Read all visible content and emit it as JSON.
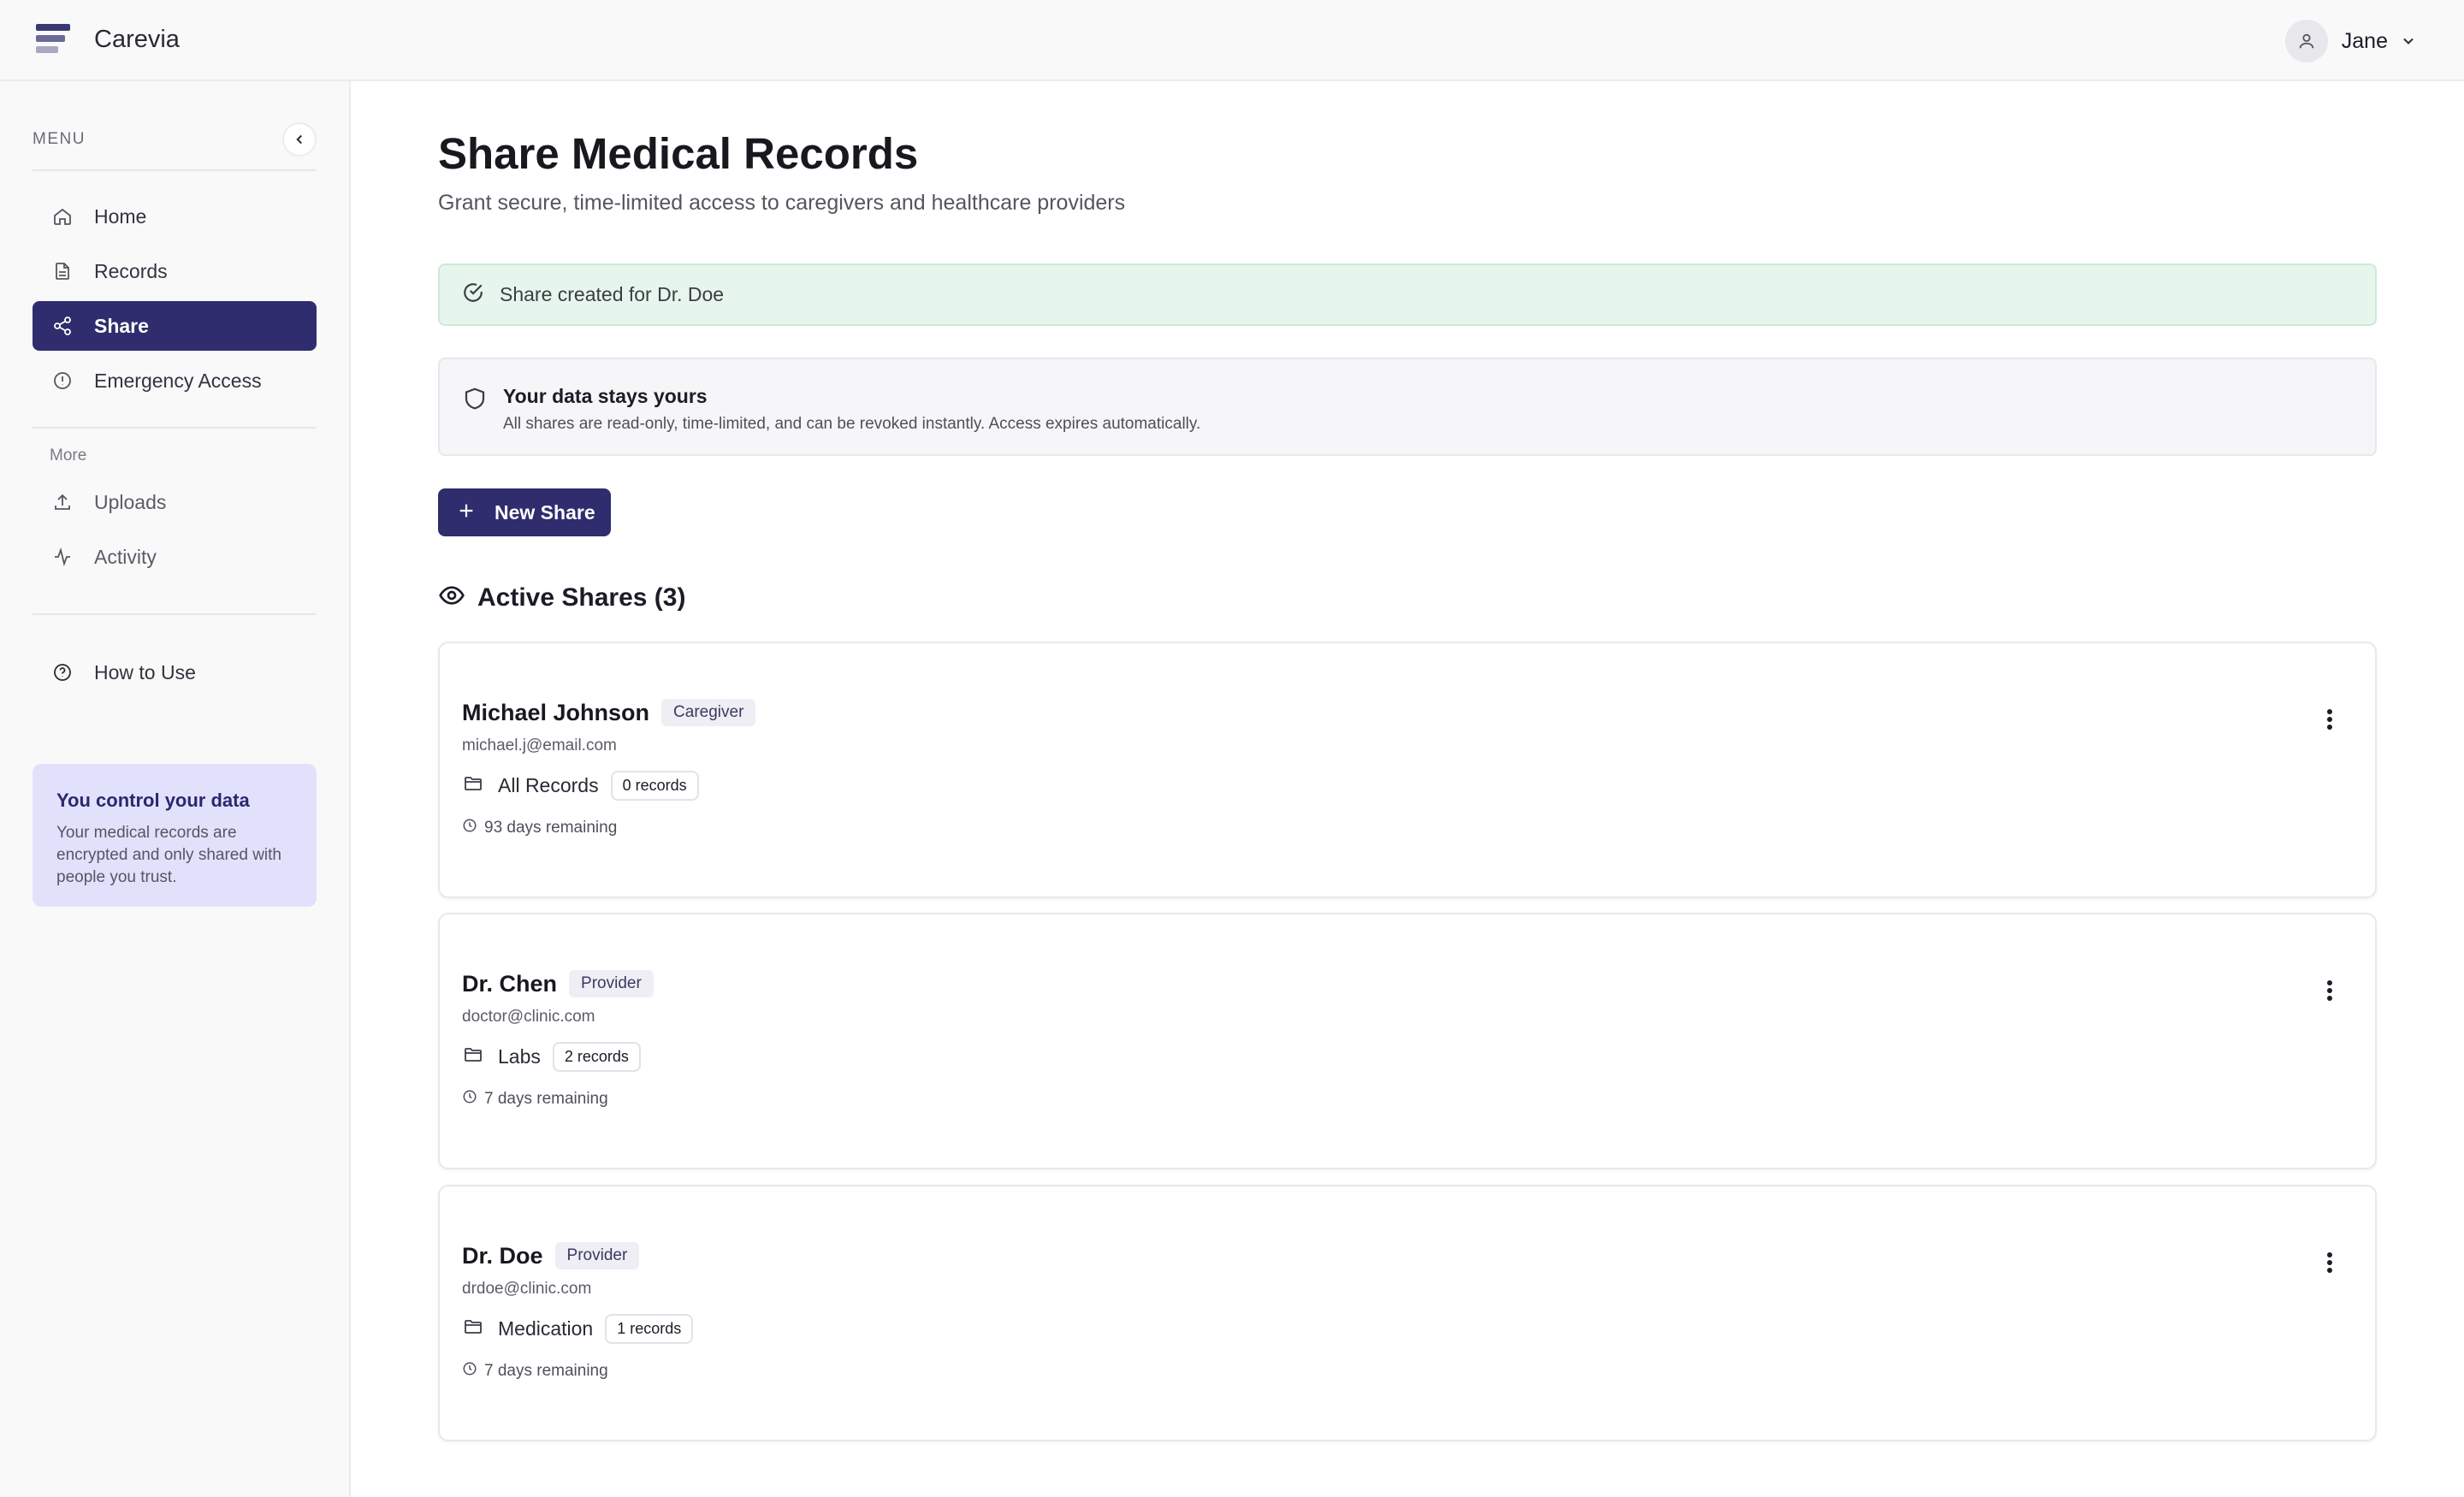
{
  "app": {
    "name": "Carevia"
  },
  "user": {
    "name": "Jane"
  },
  "sidebar": {
    "menu_label": "MENU",
    "main_items": [
      {
        "label": "Home",
        "icon": "home-icon"
      },
      {
        "label": "Records",
        "icon": "file-icon"
      },
      {
        "label": "Share",
        "icon": "share-icon",
        "active": true
      },
      {
        "label": "Emergency Access",
        "icon": "alert-circle-icon"
      }
    ],
    "more_label": "More",
    "more_items": [
      {
        "label": "Uploads",
        "icon": "upload-icon"
      },
      {
        "label": "Activity",
        "icon": "activity-icon"
      }
    ],
    "help_item": {
      "label": "How to Use",
      "icon": "help-circle-icon"
    },
    "info_card": {
      "title": "You control your data",
      "text": "Your medical records are encrypted and only shared with people you trust."
    }
  },
  "page": {
    "title": "Share Medical Records",
    "subtitle": "Grant secure, time-limited access to caregivers and healthcare providers"
  },
  "alert": {
    "text": "Share created for Dr. Doe",
    "icon": "check-circle-icon"
  },
  "privacy": {
    "title": "Your data stays yours",
    "text": "All shares are read-only, time-limited, and can be revoked instantly. Access expires automatically.",
    "icon": "shield-icon"
  },
  "new_share_button": {
    "label": "New Share"
  },
  "active_shares": {
    "heading": "Active Shares (3)",
    "items": [
      {
        "name": "Michael Johnson",
        "role": "Caregiver",
        "email": "michael.j@email.com",
        "category": "All Records",
        "count": "0 records",
        "remaining": "93 days remaining"
      },
      {
        "name": "Dr. Chen",
        "role": "Provider",
        "email": "doctor@clinic.com",
        "category": "Labs",
        "count": "2 records",
        "remaining": "7 days remaining"
      },
      {
        "name": "Dr. Doe",
        "role": "Provider",
        "email": "drdoe@clinic.com",
        "category": "Medication",
        "count": "1 records",
        "remaining": "7 days remaining"
      }
    ]
  },
  "colors": {
    "accent": "#2f2d6e",
    "success_bg": "#e7f6ec",
    "info_card_bg": "#e2e1fb"
  }
}
